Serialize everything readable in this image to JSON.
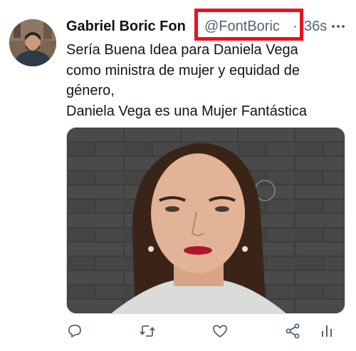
{
  "tweet": {
    "author_name": "Gabriel Boric Fon",
    "handle": "@FontBoric",
    "separator": "·",
    "time": "36s",
    "text_lines": [
      "Sería Buena Idea para Daniela Vega",
      "como ministra de mujer y equidad de",
      "género,",
      "Daniela Vega es una Mujer Fantástica"
    ]
  },
  "icons": {
    "more": "more-icon",
    "reply": "reply-icon",
    "retweet": "retweet-icon",
    "like": "like-icon",
    "share": "share-icon",
    "analytics": "analytics-icon"
  },
  "colors": {
    "highlight_box": "#e8121f",
    "secondary_text": "#536471",
    "primary_text": "#0f1419"
  }
}
